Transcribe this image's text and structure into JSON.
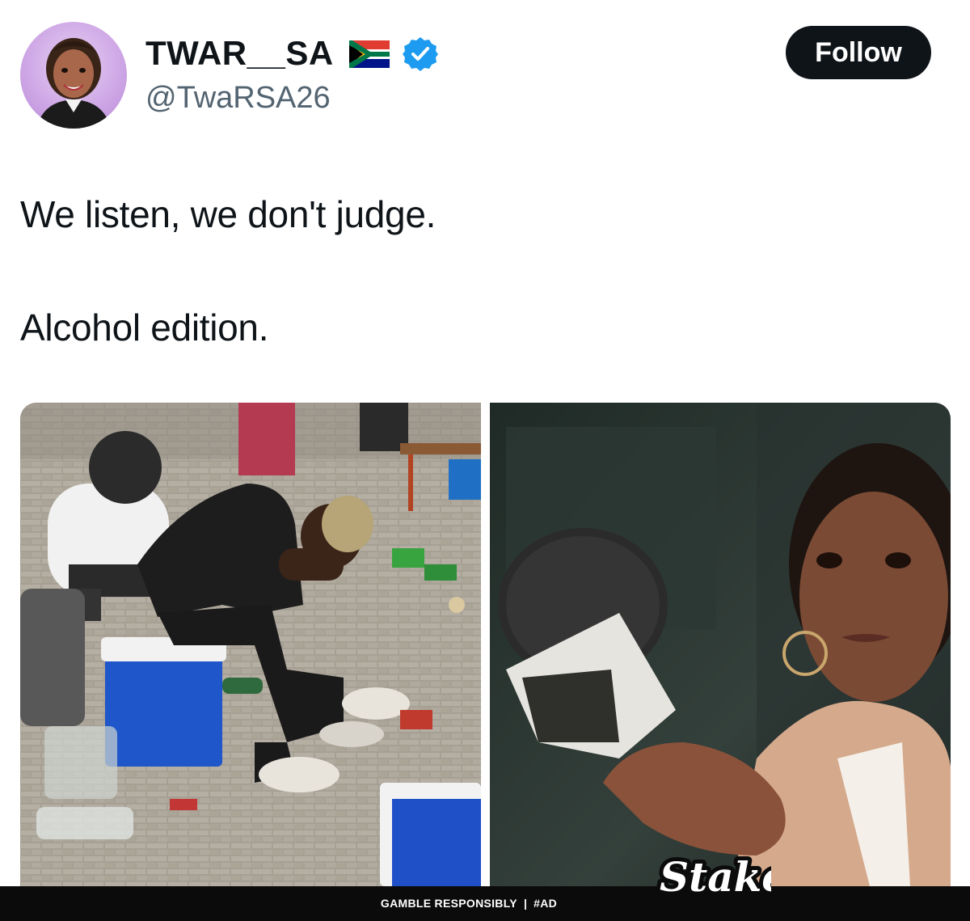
{
  "tweet": {
    "display_name": "TWAR__SA",
    "handle": "@TwaRSA26",
    "follow_label": "Follow",
    "text_line_1": "We listen, we don't judge.",
    "text_line_2": "Alcohol edition."
  },
  "ad": {
    "gamble_text": "GAMBLE RESPONSIBLY",
    "separator": "|",
    "tag": "#AD",
    "brand": "Stake"
  },
  "icons": {
    "flag": "south-africa-flag-icon",
    "verified": "verified-badge-icon"
  },
  "colors": {
    "text": "#0f1419",
    "secondary_text": "#536471",
    "follow_button": "#0f1419",
    "verified_blue": "#1d9bf0",
    "ad_bar": "#0b0b0b"
  }
}
